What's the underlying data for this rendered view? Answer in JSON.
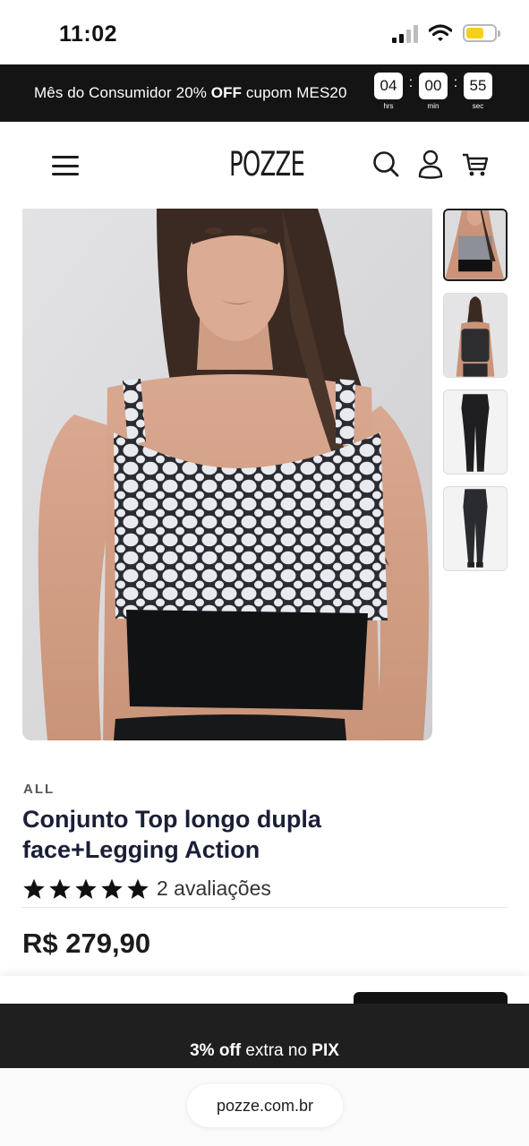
{
  "status_bar": {
    "time": "11:02"
  },
  "promo": {
    "text_before": "Mês do Consumidor 20% ",
    "text_bold": "OFF",
    "text_after": " cupom MES20",
    "countdown": [
      {
        "value": "04",
        "label": "hrs"
      },
      {
        "value": "00",
        "label": "min"
      },
      {
        "value": "55",
        "label": "sec"
      }
    ]
  },
  "header": {
    "logo": "POZZE",
    "icons": [
      "menu-icon",
      "search-icon",
      "account-icon",
      "cart-icon"
    ]
  },
  "gallery": {
    "main_image": "model-wearing-top",
    "thumbnails": [
      {
        "name": "top-front-thumb",
        "active": true
      },
      {
        "name": "top-reverse-thumb",
        "active": false
      },
      {
        "name": "legging-front-thumb",
        "active": false
      },
      {
        "name": "legging-back-thumb",
        "active": false
      }
    ]
  },
  "product": {
    "brand": "ALL",
    "title": "Conjunto Top longo dupla face+Legging Action",
    "rating_stars": 5,
    "reviews_text": "2 avaliações",
    "price": "R$ 279,90"
  },
  "pix_banner": {
    "bold_1": "3% off",
    "middle": " extra no ",
    "bold_2": "PIX"
  },
  "browser": {
    "url": "pozze.com.br"
  },
  "colors": {
    "dark": "#141414",
    "accent_battery": "#f5d01b",
    "title": "#1a1f36"
  }
}
